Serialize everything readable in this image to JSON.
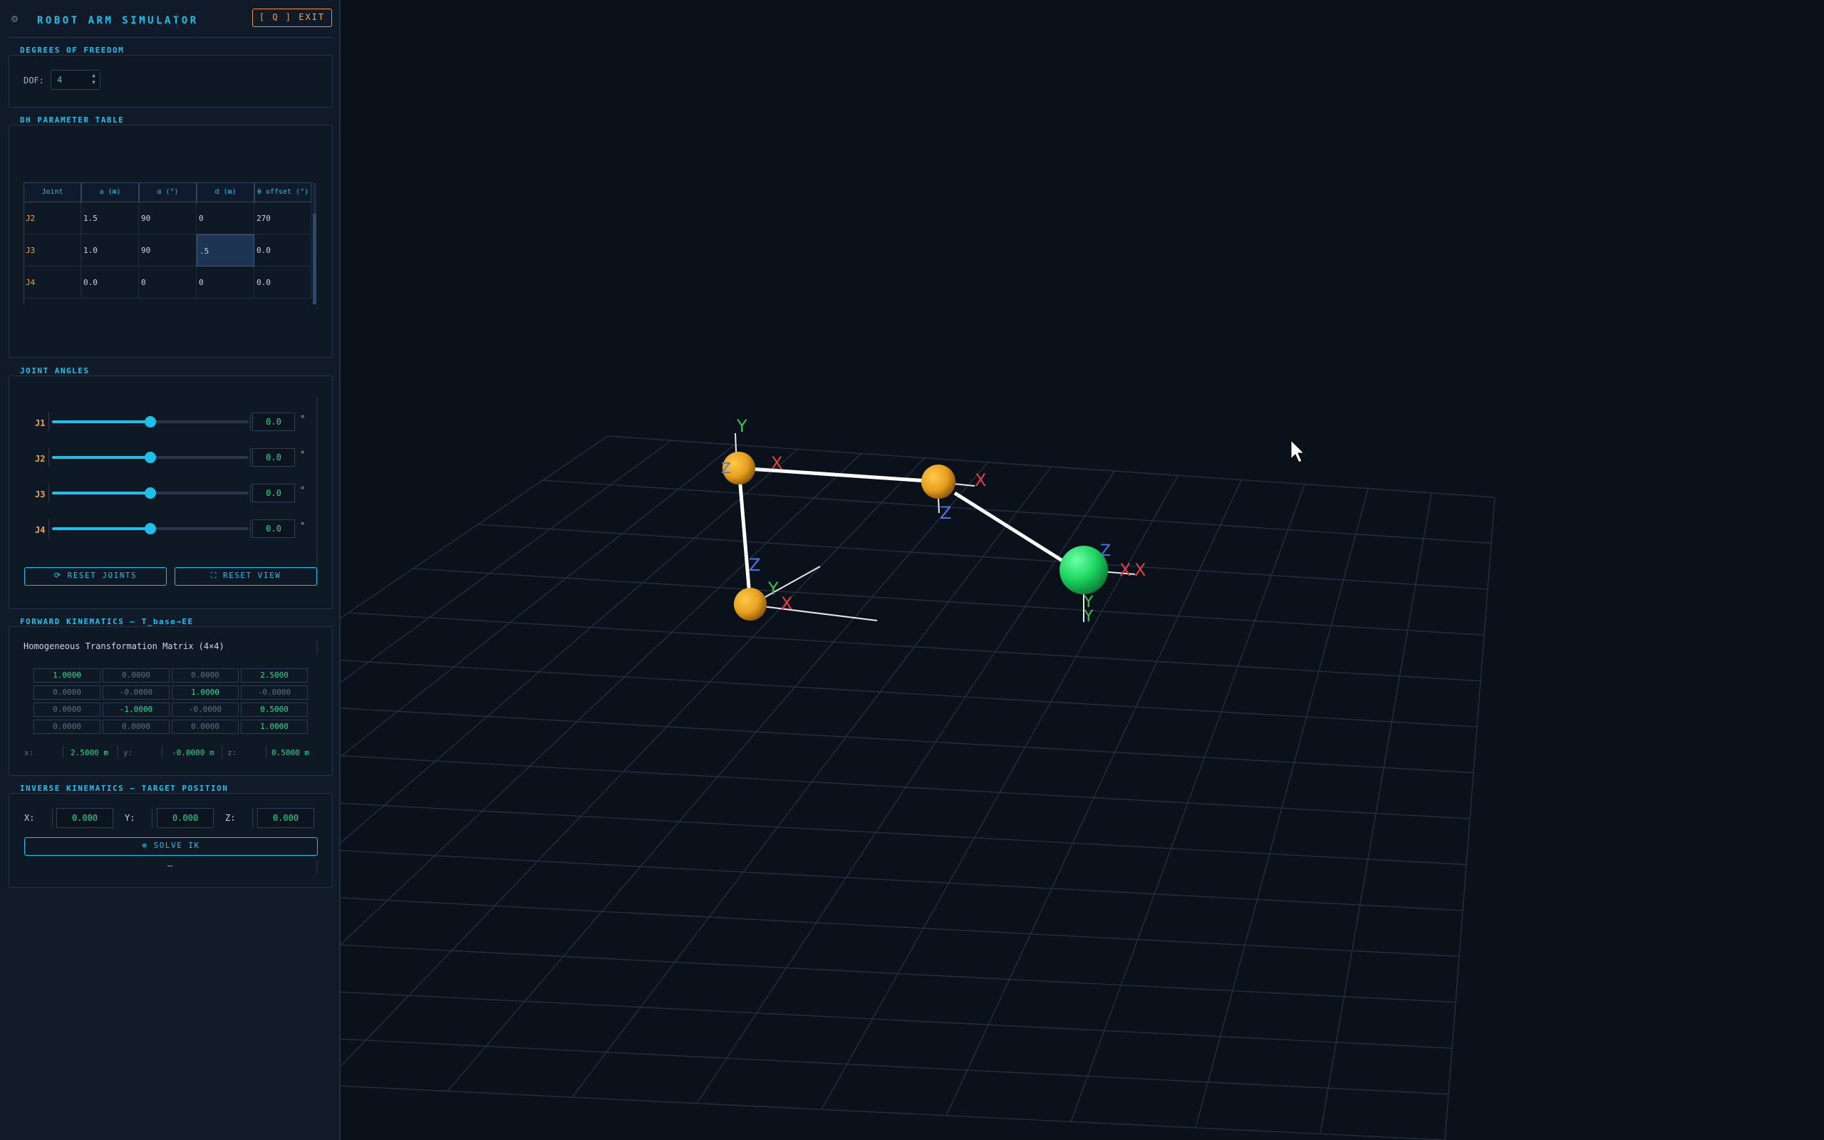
{
  "app": {
    "title": "ROBOT ARM SIMULATOR",
    "exit_label": "[ Q ] EXIT"
  },
  "dof": {
    "section_label": "DEGREES OF FREEDOM",
    "label": "DOF:",
    "value": "4"
  },
  "dh": {
    "section_label": "DH PARAMETER TABLE",
    "headers": [
      "Joint",
      "a (m)",
      "α (°)",
      "d (m)",
      "θ offset (°)"
    ],
    "rows": [
      [
        "J2",
        "1.5",
        "90",
        "0",
        "270"
      ],
      [
        "J3",
        "1.0",
        "90",
        ".5",
        "0.0"
      ],
      [
        "J4",
        "0.0",
        "0",
        "0",
        "0.0"
      ]
    ]
  },
  "joints": {
    "section_label": "JOINT ANGLES",
    "unit": "°",
    "items": [
      {
        "label": "J1",
        "value": "0.0",
        "fraction": 0.5
      },
      {
        "label": "J2",
        "value": "0.0",
        "fraction": 0.5
      },
      {
        "label": "J3",
        "value": "0.0",
        "fraction": 0.5
      },
      {
        "label": "J4",
        "value": "0.0",
        "fraction": 0.5
      }
    ],
    "reset_joints_label": "⟳ RESET JOINTS",
    "reset_view_label": "⛶ RESET VIEW"
  },
  "fk": {
    "section_label": "FORWARD KINEMATICS — T_base→EE",
    "matrix_title": "Homogeneous Transformation Matrix (4×4)",
    "matrix": [
      [
        "1.0000",
        "0.0000",
        "0.0000",
        "2.5000"
      ],
      [
        "0.0000",
        "-0.0000",
        "1.0000",
        "-0.0000"
      ],
      [
        "0.0000",
        "-1.0000",
        "-0.0000",
        "0.5000"
      ],
      [
        "0.0000",
        "0.0000",
        "0.0000",
        "1.0000"
      ]
    ],
    "highlight": [
      [
        true,
        false,
        false,
        true
      ],
      [
        false,
        false,
        true,
        false
      ],
      [
        false,
        true,
        false,
        true
      ],
      [
        false,
        false,
        false,
        true
      ]
    ],
    "pos_x_label": "x:",
    "pos_x": "2.5000 m",
    "pos_y_label": "y:",
    "pos_y": "-0.0000 m",
    "pos_z_label": "z:",
    "pos_z": "0.5000 m"
  },
  "ik": {
    "section_label": "INVERSE KINEMATICS — TARGET POSITION",
    "x_label": "X:",
    "x_value": "0.000",
    "y_label": "Y:",
    "y_value": "0.000",
    "z_label": "Z:",
    "z_value": "0.000",
    "solve_label": "⊕ SOLVE IK",
    "status": "—"
  },
  "scene": {
    "axis_labels": {
      "x": "X",
      "y": "Y",
      "z": "Z"
    },
    "colors": {
      "background": "#0b111b",
      "grid": "#243143",
      "link": "#ffffff",
      "joint": "#e8a020",
      "end_effector": "#1ed760",
      "axis_x": "#e04040",
      "axis_y": "#3fc04f",
      "axis_z": "#4a78e0"
    }
  }
}
